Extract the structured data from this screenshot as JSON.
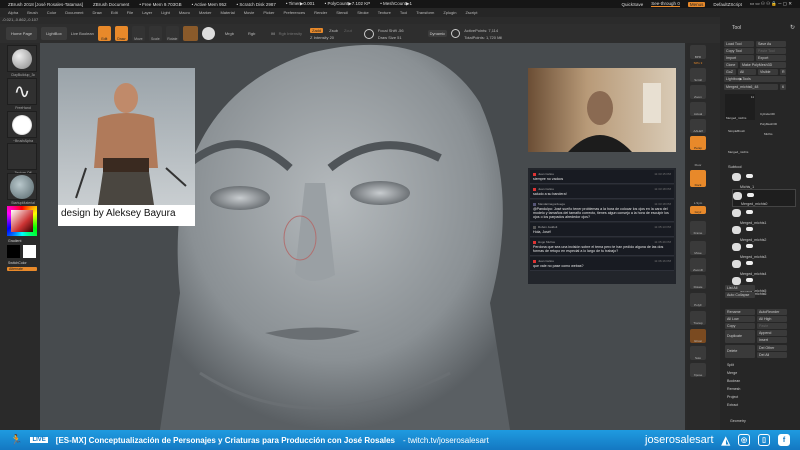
{
  "titlebar": {
    "title": "ZBrush 2018 [José Rosales-Tatamas]",
    "doc": "ZBrush Document",
    "free_mem": "• Free Mem 9.703GB",
    "active_mem": "• Active Mem 952",
    "scratch": "• Scratch Disk 2987",
    "timer": "• Timer▶0.001",
    "polycount": "• PolyCount▶7.102 KP",
    "meshcount": "• MeshCount▶1",
    "quicksave": "QuickSave",
    "see_through": "See-through 0",
    "menus": "Menus",
    "script": "DefaultZScript"
  },
  "menubar": [
    "Alpha",
    "Brush",
    "Color",
    "Document",
    "Draw",
    "Edit",
    "File",
    "Layer",
    "Light",
    "Macro",
    "Marker",
    "Material",
    "Movie",
    "Picker",
    "Preferences",
    "Render",
    "Stencil",
    "Stroke",
    "Texture",
    "Tool",
    "Transform",
    "Zplugin",
    "Zscript"
  ],
  "coords": "-0.021,-0.862,-0.107",
  "toolbar": {
    "home": "Home Page",
    "lightbox": "LightBox",
    "live_boolean": "Live Boolean",
    "edit": "Edit",
    "draw": "Draw",
    "move": "Move",
    "scale": "Scale",
    "rotate": "Rotate",
    "mrgb": "Mrgb",
    "rgb": "Rgb",
    "m": "M",
    "zadd": "Zadd",
    "zsub": "Zsub",
    "zcut": "Zcut",
    "rgb_intensity": "Rgb Intensity",
    "z_intensity": "Z Intensity 20",
    "focal_shift": "Focal Shift -56",
    "draw_size": "Draw Size 51",
    "dynamic": "Dynamic",
    "active_points": "ActivePoints: 7,114",
    "total_points": "TotalPoints: 1,720 Mil"
  },
  "leftshelf": {
    "brush": "ClayBuildup_3c",
    "stroke": "FreeHand",
    "alpha": "~BrushAlpha",
    "texture": "Texture Off",
    "material": "StartupMaterial",
    "gradient": "Gradient",
    "switch": "SwitchColor",
    "alternate": "Alternate"
  },
  "reference": {
    "caption": "design by Aleksey Bayura"
  },
  "chat": [
    {
      "user": "Juan Celtos",
      "time": "11:33:15 PM",
      "text": "siempre no vadcos"
    },
    {
      "user": "Juan Celtos",
      "time": "11:33:18 PM",
      "text": "saludo a su bandera!"
    },
    {
      "user": "Mandarinagordoega",
      "time": "11:33:18 PM",
      "text": "@Pandulpo: José sueño tener problemas a la hora de colocar los ojos en la cara del modelo y tamaños del tamaño correcto, tienes algun consejo a la hora de esculpir los ojos o los parpados alrededor ojos?"
    },
    {
      "user": "Rubén Jaddult",
      "time": "11:35:13 PM",
      "text": "Hola, José!"
    },
    {
      "user": "Hugo Muños",
      "time": "11:35:49 PM",
      "text": "Perdona que sea una incisión sobre el tema pero te han pedido alguna de las dos formas de retopo en especial a lo largo de tu trabajo?"
    },
    {
      "user": "Juan Celtos",
      "time": "11:36:16 PM",
      "text": "que vale no pase como webas?"
    }
  ],
  "rightshelf": [
    "BPR",
    "SPix 3",
    "Scroll",
    "Zoom",
    "Actual",
    "AAHalf",
    "Persp",
    "Floor",
    "Dock",
    "L.Sym",
    "Gxyz",
    "Frame",
    "Move",
    "ZoomD",
    "Rotate",
    "PolyF",
    "Transp",
    "Ghost",
    "Solo",
    "Xpose"
  ],
  "toolpanel": {
    "title": "Tool",
    "buttons": [
      "Load Tool",
      "Save As",
      "Copy Tool",
      "Paste Tool",
      "Import",
      "Export",
      "Clone",
      "Make PolyMesh3D",
      "GoZ",
      "All",
      "Visible",
      "R",
      "Lightbox▶Tools",
      "Merged_michis6_48",
      "6"
    ],
    "tools": [
      "Merged_michis",
      "Cylinder3D",
      "PolyMesh3D",
      "SimpleBrush",
      "Michis",
      "Merged_michis"
    ],
    "tool_count": "11",
    "subtool_title": "Subtool",
    "subtools": [
      "Michis_1",
      "Merged_michis0",
      "Merged_michis1",
      "Merged_michis2",
      "Merged_michis3",
      "Merged_michis4",
      "Merged_michis5",
      "Merged_michis6"
    ],
    "actions": [
      "List All",
      "Auto Collapse",
      "Rename",
      "AutoReorder",
      "All Low",
      "All High",
      "Copy",
      "Paste",
      "Duplicate",
      "Append",
      "Insert",
      "Delete",
      "Del Other",
      "Del All"
    ],
    "list": [
      "Split",
      "Merge",
      "Boolean",
      "Remesh",
      "Project",
      "Extract"
    ],
    "geometry": "Geometry"
  },
  "banner": {
    "live": "LIVE",
    "title": "[ES-MX] Conceptualización de Personajes y Criaturas para Producción con José Rosales",
    "url": "- twitch.tv/joserosalesart",
    "handle": "joserosalesart"
  },
  "colors": {
    "accent": "#e8892a",
    "banner": "#1a8fd6",
    "canvas": "#474b4e"
  }
}
